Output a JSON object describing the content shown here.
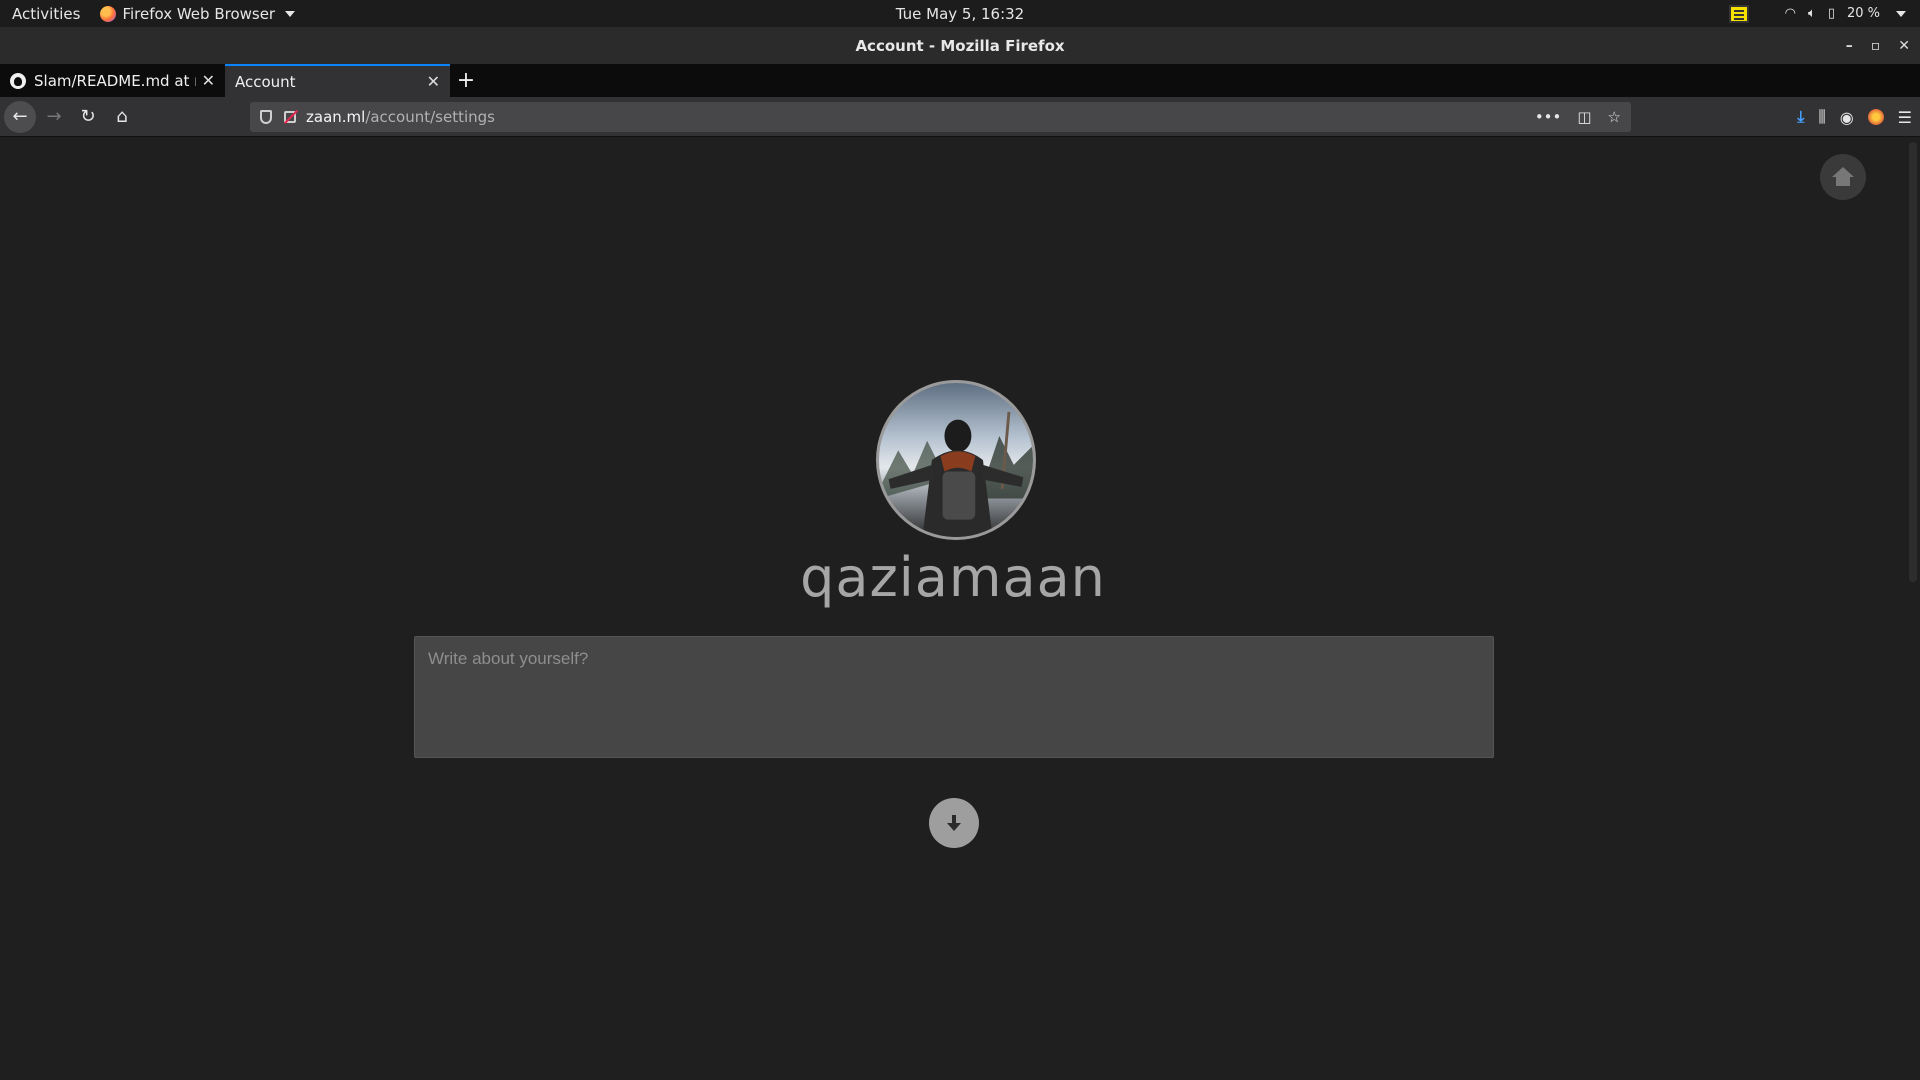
{
  "system": {
    "activities": "Activities",
    "app_name": "Firefox Web Browser",
    "clock": "Tue May  5, 16:32",
    "battery": "20 %"
  },
  "window": {
    "title": "Account - Mozilla Firefox"
  },
  "tabs": [
    {
      "label": "Slam/README.md at ma",
      "icon": "github-icon",
      "active": false
    },
    {
      "label": "Account",
      "icon": "none",
      "active": true
    }
  ],
  "address_bar": {
    "host": "zaan.ml",
    "path": "/account/settings"
  },
  "profile": {
    "username": "qaziamaan",
    "bio_value": "",
    "bio_placeholder": "Write about yourself?"
  },
  "colors": {
    "page_background": "#1f1f1f",
    "input_background": "#464646",
    "fab_background": "#9e9e9e",
    "accent_tab": "#0a84ff"
  }
}
